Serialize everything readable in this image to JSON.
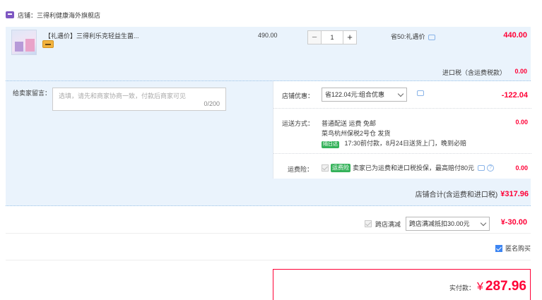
{
  "shop": {
    "label": "店铺：三得利健康海外旗舰店"
  },
  "item": {
    "title": "【礼遇价】三得利乐克轻益生菌...",
    "unit_price": "490.00",
    "quantity": "1",
    "minus": "−",
    "plus": "+",
    "discount": "省50:礼遇价",
    "subtotal": "440.00"
  },
  "tax": {
    "label": "进口税（含运费税款）",
    "value": "0.00"
  },
  "message": {
    "label": "给卖家留言：",
    "placeholder": "选填，请先和商家协商一致，付款后商家可见",
    "counter": "0/200"
  },
  "shop_coupon": {
    "label": "店铺优惠：",
    "selected": "省122.04元:组合优惠",
    "value": "-122.04"
  },
  "shipping": {
    "label": "运送方式：",
    "method": "普通配送 运费 免邮",
    "warehouse": "菜鸟杭州保税2号仓  发货",
    "badge": "隔日达",
    "eta": "17:30前付款，8月24日送货上门，晚到必赔",
    "value": "0.00"
  },
  "insurance": {
    "label": "运费险：",
    "badge": "运费险",
    "text": "卖家已为运费和进口税投保，最高赔付80元",
    "value": "0.00"
  },
  "shop_total": {
    "label": "店铺合计(含运费和进口税)",
    "value": "¥317.96"
  },
  "cross_store": {
    "label": "跨店满减",
    "selected": "跨店满减抵扣30.00元",
    "value": "¥-30.00"
  },
  "anonymous": {
    "label": "匿名购买"
  },
  "payment": {
    "label": "实付款：",
    "currency": "¥",
    "amount": "287.96"
  },
  "colors": {
    "accent_red": "#ff0036",
    "panel_blue": "#eaf3fc",
    "checkbox_blue": "#3d85f2"
  }
}
